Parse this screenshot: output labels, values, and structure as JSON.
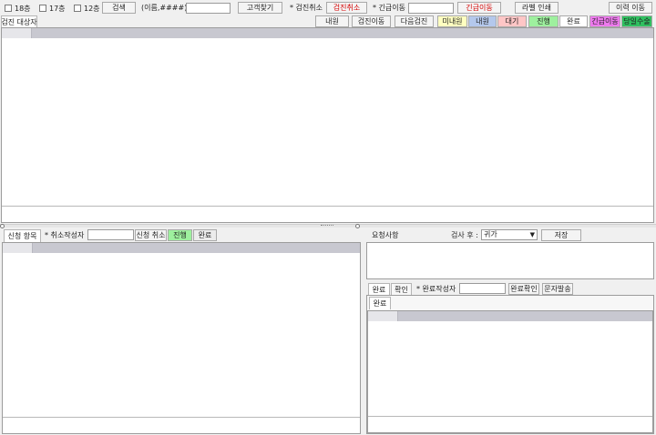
{
  "toolbar": {
    "floor_checks": [
      "18층",
      "17층",
      "12층"
    ],
    "search_label": "검색",
    "search_hint": "(이름,####)",
    "find_customer_label": "고객찾기",
    "cancel_section_label": "* 검진취소",
    "cancel_button_label": "검진취소",
    "emergency_section_label": "* 긴급이동",
    "emergency_button_label": "긴급이동",
    "label_print_label": "라벨 인쇄",
    "history_move_label": "이력 이동"
  },
  "top_panel": {
    "tab_label": "검진 대상자",
    "actions": [
      "내원",
      "검진이동",
      "다음검진"
    ],
    "status_legend": [
      {
        "label": "미내원",
        "color": "#ffffc0"
      },
      {
        "label": "내원",
        "color": "#b4c8ec"
      },
      {
        "label": "대기",
        "color": "#ffc6c6"
      },
      {
        "label": "진행",
        "color": "#9ef09e"
      },
      {
        "label": "완료",
        "color": "#ffffff"
      },
      {
        "label": "긴급이동",
        "color": "#ee7aee"
      },
      {
        "label": "당일수술",
        "color": "#30c060"
      }
    ]
  },
  "left_panel": {
    "tab_label": "신청 항목",
    "cancel_writer_label": "* 취소작성자",
    "cancel_request_label": "신청 취소",
    "status_progress_label": "진행",
    "status_progress_color": "#9ef09e",
    "status_done_label": "완료"
  },
  "request_panel": {
    "label": "요청사항",
    "after_exam_label": "검사 후 :",
    "after_exam_value": "귀가",
    "save_label": "저장"
  },
  "completion_panel": {
    "tabs": [
      "완료",
      "확인"
    ],
    "writer_label": "* 완료작성자",
    "confirm_label": "완료확인",
    "sms_label": "문자발송",
    "inner_tab_label": "완료"
  }
}
